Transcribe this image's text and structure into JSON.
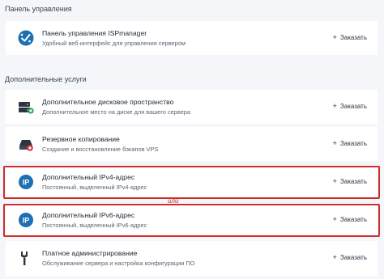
{
  "sections": {
    "control_panel": "Панель управления",
    "additional_services": "Дополнительные услуги"
  },
  "order_label": "Заказать",
  "or_label": "или",
  "cards": [
    {
      "name": "Панель управления ISPmanager",
      "desc": "Удобный веб-интерфейс для управления сервером",
      "icon": "ispmanager-icon"
    },
    {
      "name": "Дополнительное дисковое пространство",
      "desc": "Дополнительное место на диске для вашего сервера",
      "icon": "disk-icon"
    },
    {
      "name": "Резервное копирование",
      "desc": "Создание и восстановление бэкапов VPS",
      "icon": "backup-icon"
    },
    {
      "name": "Дополнительный IPv4-адрес",
      "desc": "Постоянный, выделенный IPv4-адрес",
      "icon": "ip-icon"
    },
    {
      "name": "Дополнительный IPv6-адрес",
      "desc": "Постоянный, выделенный IPv6-адрес",
      "icon": "ip-icon"
    },
    {
      "name": "Платное администрирование",
      "desc": "Обслуживание сервера и настройка конфигурации ПО",
      "icon": "admin-tools-icon"
    }
  ],
  "colors": {
    "accent": "#1e6fb3",
    "highlight": "#cc2d2d",
    "background": "#f4f6f9"
  }
}
